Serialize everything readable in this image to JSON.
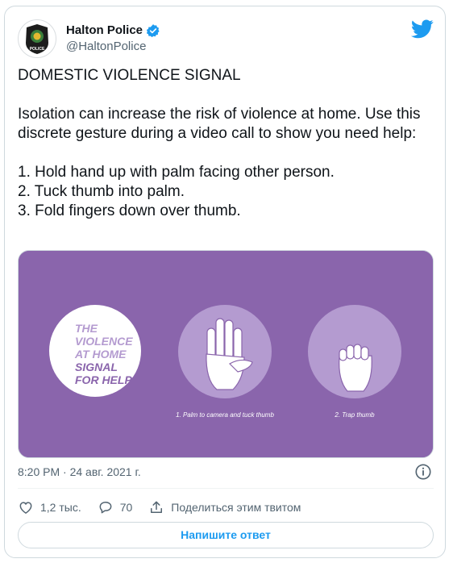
{
  "author": {
    "name": "Halton Police",
    "handle": "@HaltonPolice",
    "verified": true,
    "badge_text": "POLICE"
  },
  "tweet": {
    "text": "DOMESTIC VIOLENCE SIGNAL\n\nIsolation can increase the risk of violence at home. Use this discrete gesture during a video call to show you need help:\n\n1. Hold hand up with palm facing other person.\n2. Tuck thumb into palm.\n3. Fold fingers down over thumb.",
    "timestamp": "8:20 PM · 24 авг. 2021 г."
  },
  "media": {
    "background_color": "#8a65ac",
    "circle_text": [
      "THE",
      "VIOLENCE",
      "AT HOME",
      "SIGNAL",
      "FOR HELP"
    ],
    "step1_caption": "1. Palm to camera and tuck thumb",
    "step2_caption": "2. Trap thumb"
  },
  "actions": {
    "likes": "1,2 тыс.",
    "replies": "70",
    "share_label": "Поделиться этим твитом"
  },
  "reply_button": "Напишите ответ",
  "colors": {
    "accent": "#1d9bf0",
    "muted": "#536471",
    "purple": "#8a65ac",
    "light_purple": "#b49bd0"
  }
}
